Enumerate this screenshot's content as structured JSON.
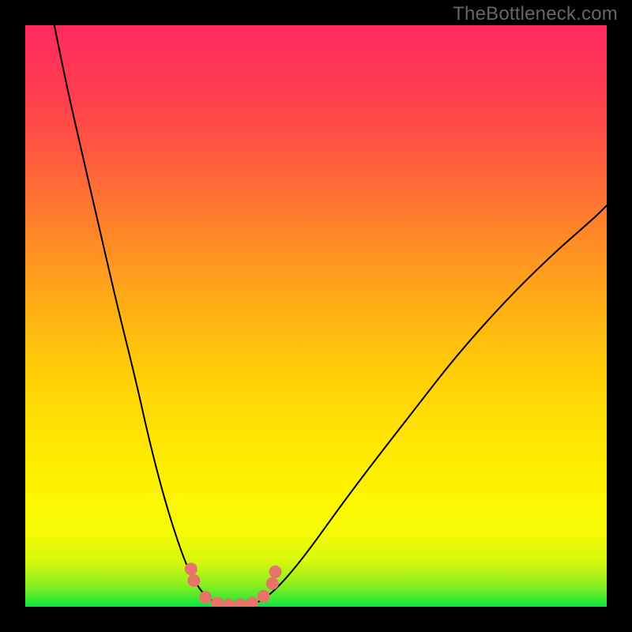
{
  "watermark": "TheBottleneck.com",
  "colors": {
    "frame": "#000000",
    "gradient_top": "#ff2a5d",
    "gradient_mid_upper": "#ff7a2f",
    "gradient_mid": "#ffe703",
    "gradient_lower": "#92ef1d",
    "gradient_bottom": "#00e648",
    "curve": "#000000",
    "beads": "#e77468"
  },
  "chart_data": {
    "type": "line",
    "title": "",
    "xlabel": "",
    "ylabel": "",
    "xlim": [
      0,
      100
    ],
    "ylim": [
      0,
      100
    ],
    "grid": false,
    "series": [
      {
        "name": "left-branch",
        "x": [
          5,
          7,
          10,
          13,
          16,
          19,
          21,
          23,
          25,
          27,
          28.5,
          30,
          31.5,
          33
        ],
        "values": [
          100,
          90,
          77,
          64,
          51,
          39,
          30,
          22,
          15,
          9,
          5.5,
          3,
          1.4,
          0.6
        ]
      },
      {
        "name": "valley-floor",
        "x": [
          33,
          34,
          35,
          36,
          37,
          38,
          39,
          40
        ],
        "values": [
          0.6,
          0.35,
          0.25,
          0.2,
          0.25,
          0.35,
          0.5,
          0.8
        ]
      },
      {
        "name": "right-branch",
        "x": [
          40,
          42,
          45,
          49,
          54,
          60,
          67,
          74,
          82,
          90,
          98,
          100
        ],
        "values": [
          0.8,
          2,
          5,
          10,
          17,
          25,
          34,
          43,
          52,
          60,
          67,
          69
        ]
      }
    ],
    "markers": [
      {
        "name": "bead",
        "x": 28.5,
        "y": 6.5
      },
      {
        "name": "bead",
        "x": 29,
        "y": 4.5
      },
      {
        "name": "bead",
        "x": 31,
        "y": 1.6
      },
      {
        "name": "bead",
        "x": 33,
        "y": 0.6
      },
      {
        "name": "bead",
        "x": 35,
        "y": 0.3
      },
      {
        "name": "bead",
        "x": 37,
        "y": 0.3
      },
      {
        "name": "bead",
        "x": 39,
        "y": 0.6
      },
      {
        "name": "bead",
        "x": 41,
        "y": 1.8
      },
      {
        "name": "bead",
        "x": 42.5,
        "y": 4.0
      },
      {
        "name": "bead",
        "x": 43,
        "y": 6.0
      }
    ]
  }
}
